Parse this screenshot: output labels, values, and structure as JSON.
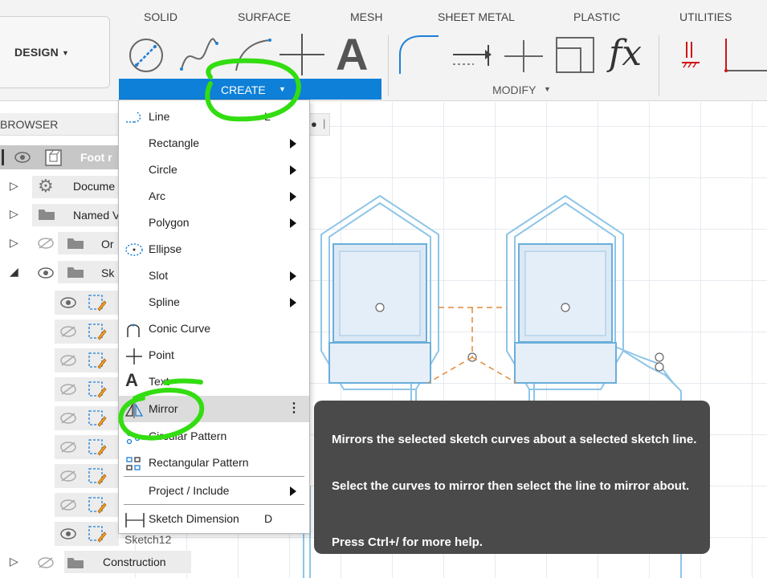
{
  "toolbar": {
    "workspace_label": "DESIGN",
    "tabs": [
      "SOLID",
      "SURFACE",
      "MESH",
      "SHEET METAL",
      "PLASTIC",
      "UTILITIES"
    ],
    "create_label": "CREATE",
    "modify_label": "MODIFY",
    "tools": [
      "create-sketch-icon",
      "spline-icon",
      "arc-icon",
      "point-icon",
      "text-icon",
      "fillet-icon",
      "offset-icon",
      "trim-icon",
      "scale-icon",
      "function-icon",
      "constraint-icon",
      "line-constraint-icon"
    ],
    "accent_color": "#0e80d8"
  },
  "browser": {
    "title": "BROWSER",
    "items": [
      {
        "label": "Foot r",
        "icon": "component-icon",
        "visible": true
      },
      {
        "label": "Docume",
        "icon": "gear-icon"
      },
      {
        "label": "Named V",
        "icon": "folder-icon"
      },
      {
        "label": "Or",
        "icon": "folder-icon",
        "visible": false
      },
      {
        "label": "Sk",
        "icon": "folder-icon",
        "visible": true
      },
      {
        "label": "Sketch12",
        "icon": "sketch-icon"
      },
      {
        "label": "Construction",
        "icon": "folder-icon",
        "visible": false
      }
    ]
  },
  "menu": {
    "items": [
      {
        "label": "Line",
        "shortcut": "L",
        "icon": "line-icon",
        "submenu": false
      },
      {
        "label": "Rectangle",
        "submenu": true
      },
      {
        "label": "Circle",
        "submenu": true
      },
      {
        "label": "Arc",
        "submenu": true
      },
      {
        "label": "Polygon",
        "submenu": true
      },
      {
        "label": "Ellipse",
        "icon": "ellipse-icon",
        "submenu": false
      },
      {
        "label": "Slot",
        "submenu": true
      },
      {
        "label": "Spline",
        "submenu": true
      },
      {
        "label": "Conic Curve",
        "icon": "conic-curve-icon",
        "submenu": false
      },
      {
        "label": "Point",
        "icon": "point-icon",
        "submenu": false
      },
      {
        "label": "Text",
        "icon": "text-icon",
        "submenu": false
      },
      {
        "label": "Mirror",
        "icon": "mirror-icon",
        "submenu": false,
        "highlighted": true,
        "more": "⋮"
      },
      {
        "label": "Circular Pattern",
        "icon": "circular-pattern-icon",
        "submenu": false
      },
      {
        "label": "Rectangular Pattern",
        "icon": "rectangular-pattern-icon",
        "submenu": false
      },
      {
        "label": "Project / Include",
        "submenu": true
      },
      {
        "label": "Sketch Dimension",
        "shortcut": "D",
        "icon": "sketch-dimension-icon",
        "submenu": false
      }
    ]
  },
  "tooltip": {
    "description": "Mirrors the selected sketch curves about a selected sketch line.",
    "instructions": "Select the curves to mirror then select the line to mirror about.",
    "help": "Press Ctrl+/ for more help."
  },
  "annotation_color": "#33dd11"
}
